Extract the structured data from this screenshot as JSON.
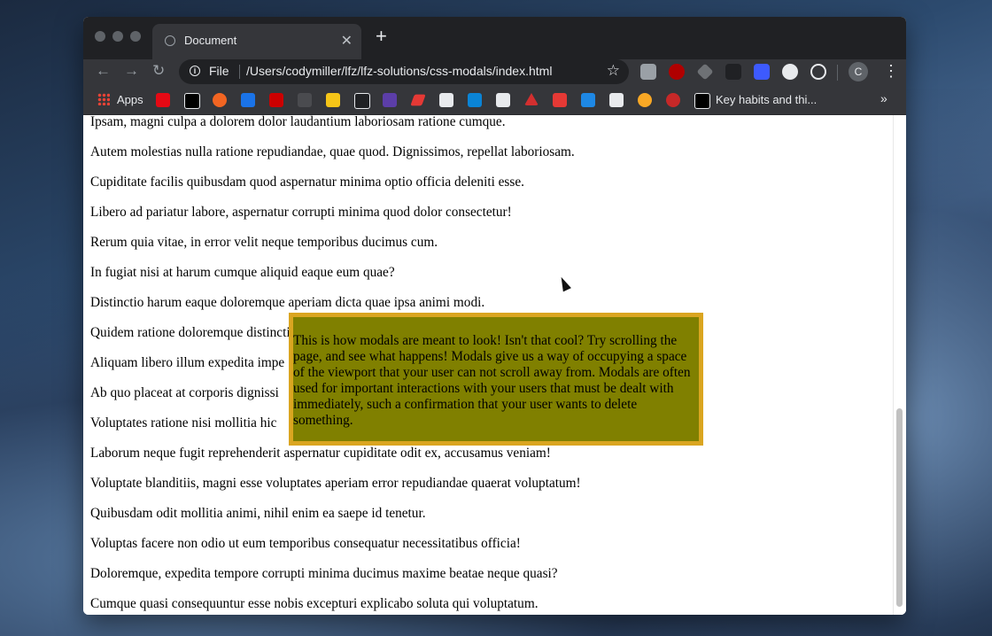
{
  "browser": {
    "tab_title": "Document",
    "tab_close": "✕",
    "new_tab": "+",
    "omnibox": {
      "scheme_label": "File",
      "url": "/Users/codymiller/lfz/lfz-solutions/css-modals/index.html"
    },
    "profile_initial": "C",
    "bookmarks": {
      "apps_label": "Apps",
      "last_label": "Key habits and thi...",
      "overflow": "»"
    }
  },
  "page": {
    "paragraphs": [
      "Ipsam, magni culpa a dolorem dolor laudantium laboriosam ratione cumque.",
      "Autem molestias nulla ratione repudiandae, quae quod. Dignissimos, repellat laboriosam.",
      "Cupiditate facilis quibusdam quod aspernatur minima optio officia deleniti esse.",
      "Libero ad pariatur labore, aspernatur corrupti minima quod dolor consectetur!",
      "Rerum quia vitae, in error velit neque temporibus ducimus cum.",
      "In fugiat nisi at harum cumque aliquid eaque eum quae?",
      "Distinctio harum eaque doloremque aperiam dicta quae ipsa animi modi.",
      "Quidem ratione doloremque distinctio",
      "Aliquam libero illum expedita impe",
      "Ab quo placeat at corporis dignissi",
      "Voluptates ratione nisi mollitia hic",
      "Laborum neque fugit reprehenderit aspernatur cupiditate odit ex, accusamus veniam!",
      "Voluptate blanditiis, magni esse voluptates aperiam error repudiandae quaerat voluptatum!",
      "Quibusdam odit mollitia animi, nihil enim ea saepe id tenetur.",
      "Voluptas facere non odio ut eum temporibus consequatur necessitatibus officia!",
      "Doloremque, expedita tempore corrupti minima ducimus maxime beatae neque quasi?",
      "Cumque quasi consequuntur esse nobis excepturi explicabo soluta qui voluptatum."
    ],
    "modal_text": "This is how modals are meant to look! Isn't that cool? Try scrolling the page, and see what happens! Modals give us a way of occupying a space of the viewport that your user can not scroll away from. Modals are often used for important interactions with your users that must be dealt with immediately, such a confirmation that your user wants to delete something."
  },
  "colors": {
    "modal_bg": "#808000",
    "modal_border": "#daa520"
  }
}
